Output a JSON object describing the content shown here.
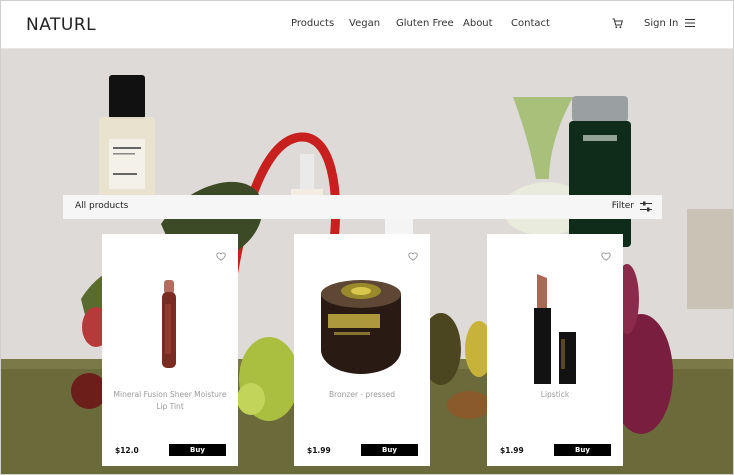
{
  "brand": {
    "logo": "NATURL"
  },
  "nav": {
    "items": [
      {
        "label": "Products"
      },
      {
        "label": "Vegan"
      },
      {
        "label": "Gluten Free"
      },
      {
        "label": "About"
      },
      {
        "label": "Contact"
      }
    ],
    "sign_in": "Sign In",
    "icons": [
      "cart-icon",
      "menu-icon"
    ]
  },
  "filter_bar": {
    "title": "All products",
    "filter_label": "Filter",
    "filter_icon": "sliders-icon"
  },
  "products": [
    {
      "name": "Mineral Fusion Sheer Moisture Lip Tint",
      "price": "$12.0",
      "button": "Buy"
    },
    {
      "name": "Bronzer - pressed",
      "price": "$1.99",
      "button": "Buy"
    },
    {
      "name": "Lipstick",
      "price": "$1.99",
      "button": "Buy"
    }
  ],
  "colors": {
    "button_bg": "#000000",
    "button_text": "#ffffff",
    "product_name": "#9a9a9a",
    "hero_wall": "#dedad7",
    "hero_floor": "#6b6a3a"
  }
}
